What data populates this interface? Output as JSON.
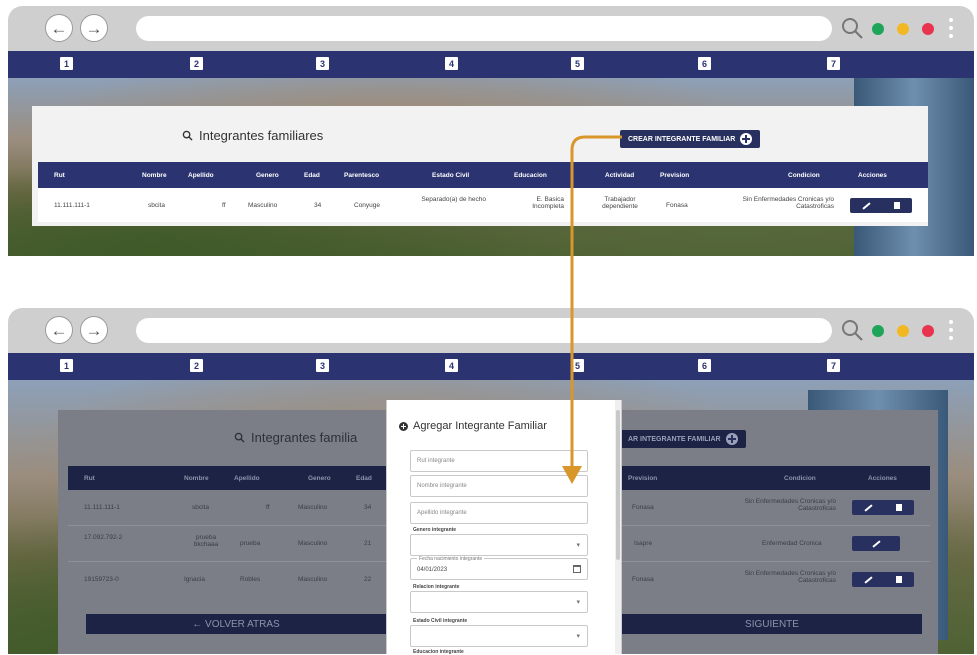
{
  "nav_numbers": [
    "1",
    "2",
    "3",
    "4",
    "5",
    "6",
    "7"
  ],
  "icons": {
    "back": "back-arrow-icon",
    "forward": "forward-arrow-icon",
    "search": "search-icon",
    "menu": "vertical-dots-icon"
  },
  "colors": {
    "nav_bar": "#2b3470",
    "accent": "#27305e",
    "connector": "#d9962b",
    "dot_green": "#1fa55a",
    "dot_yellow": "#f2b824",
    "dot_red": "#e8344c"
  },
  "top_screen": {
    "title": "Integrantes familiares",
    "create_button": "CREAR INTEGRANTE FAMILIAR",
    "columns": [
      "Rut",
      "Nombre",
      "Apellido",
      "Genero",
      "Edad",
      "Parentesco",
      "Estado Civil",
      "Educacion",
      "Actividad",
      "Prevision",
      "Condicion",
      "Acciones"
    ],
    "rows": [
      {
        "rut": "11.111.111-1",
        "nombre": "sbcita",
        "apellido": "ff",
        "genero": "Masculino",
        "edad": "34",
        "parentesco": "Conyuge",
        "estado_civil": "Separado(a) de hecho",
        "educacion": "E. Basica Incompleta",
        "actividad": "Trabajador dependiente",
        "prevision": "Fonasa",
        "condicion": "Sin Enfermedades Cronicas y/o Catastroficas"
      }
    ]
  },
  "bottom_screen": {
    "title": "Integrantes familia",
    "create_button": "AR INTEGRANTE FAMILIAR",
    "columns": [
      "Rut",
      "Nombre",
      "Apellido",
      "Genero",
      "Edad",
      "Prevision",
      "Condicion",
      "Acciones"
    ],
    "rows": [
      {
        "rut": "11.111.111-1",
        "nombre": "sbcita",
        "apellido": "ff",
        "genero": "Masculino",
        "edad": "34",
        "prevision": "Fonasa",
        "condicion": "Sin Enfermedades Cronicas y/o Catastroficas"
      },
      {
        "rut": "17.092.792-2",
        "nombre": "prueba bkchaaa",
        "apellido": "prueba",
        "genero": "Masculino",
        "edad": "21",
        "prevision": "Isapre",
        "condicion": "Enfermedad Cronica"
      },
      {
        "rut": "19159723-0",
        "nombre": "Ignacia",
        "apellido": "Robles",
        "genero": "Masculino",
        "edad": "22",
        "prevision": "Fonasa",
        "condicion": "Sin Enfermedades Cronicas y/o Catastroficas"
      }
    ],
    "back_button": "← VOLVER ATRAS",
    "next_button": "SIGUIENTE"
  },
  "modal": {
    "title": "Agregar Integrante Familiar",
    "rut_placeholder": "Rut integrante",
    "name_placeholder": "Nombre integrante",
    "surname_placeholder": "Apellido integrante",
    "gender_label": "Genero integrante",
    "birth_label": "Fecha nacimiento integrante",
    "birth_value": "04/01/2023",
    "relation_label": "Relacion integrante",
    "civil_label": "Estado Civil integrante",
    "education_label": "Educacion integrante"
  }
}
